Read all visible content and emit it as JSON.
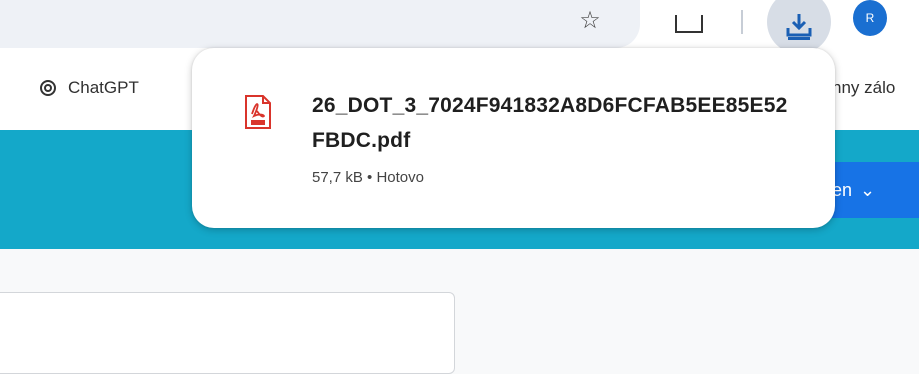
{
  "toolbar": {
    "star_glyph": "☆",
    "avatar_letter": "R"
  },
  "bookmarks": {
    "chatgpt_label": "ChatGPT",
    "right_label": "hny zálo"
  },
  "banner": {
    "button_label": "ášen",
    "chevron": "⌄"
  },
  "download": {
    "filename": "26_DOT_3_7024F941832A8D6FCFAB5EE85E52FBDC.pdf",
    "status": "57,7 kB • Hotovo",
    "icon": "pdf-file-icon"
  },
  "colors": {
    "banner": "#14a8c9",
    "button": "#1773e6",
    "pdf_red": "#d9342b"
  }
}
